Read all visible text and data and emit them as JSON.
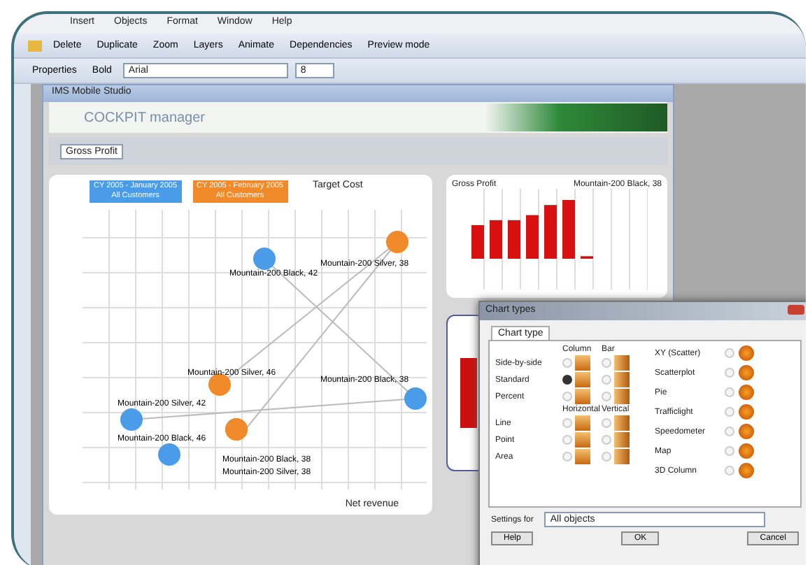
{
  "menu": [
    "Insert",
    "Objects",
    "Format",
    "Window",
    "Help"
  ],
  "toolbar_1": [
    "Delete",
    "Duplicate",
    "Zoom",
    "Layers",
    "Animate",
    "Dependencies",
    "Preview mode"
  ],
  "toolbar_2": {
    "properties": "Properties",
    "bold": "Bold",
    "font": "Arial",
    "size": "8"
  },
  "inner_window": {
    "title": "IMS Mobile Studio",
    "logo": "COCKPIT manager",
    "filter": "Gross Profit"
  },
  "scatter": {
    "legend": [
      {
        "label": "CY 2005 - January 2005",
        "sub": "All Customers",
        "color": "#4a9be8"
      },
      {
        "label": "CY 2005 - February 2005",
        "sub": "All Customers",
        "color": "#f08a2a"
      }
    ],
    "title": "Target Cost",
    "xlabel": "Net revenue",
    "points": [
      {
        "label": "Mountain-200 Black, 42",
        "color": "#4a9be8"
      },
      {
        "label": "Mountain-200 Silver, 38",
        "color": "#f08a2a"
      },
      {
        "label": "Mountain-200 Silver, 46",
        "color": "#f08a2a"
      },
      {
        "label": "Mountain-200 Black, 38",
        "color": "#4a9be8"
      },
      {
        "label": "Mountain-200 Silver, 42",
        "color": "#4a9be8"
      },
      {
        "label": "Mountain-200 Black, 46",
        "color": "#4a9be8"
      },
      {
        "label": "Mountain-200 Black, 38",
        "color": "#f08a2a"
      },
      {
        "label": "Mountain-200 Silver, 38",
        "color": "#f08a2a"
      }
    ]
  },
  "bar_panel": {
    "title": "Gross Profit",
    "series": "Mountain-200 Black, 38"
  },
  "dialog": {
    "title": "Chart types",
    "tab": "Chart type",
    "headers": [
      "Column",
      "Bar"
    ],
    "headers_2": [
      "Horizontal",
      "Vertical"
    ],
    "rows": [
      {
        "label": "Side-by-side",
        "selected": false,
        "bar_selected": false
      },
      {
        "label": "Standard",
        "selected": true,
        "bar_selected": false
      },
      {
        "label": "Percent",
        "selected": false,
        "bar_selected": false
      },
      {
        "label": "Line",
        "selected": false,
        "bar_selected": false
      },
      {
        "label": "Point",
        "selected": false,
        "bar_selected": false
      },
      {
        "label": "Area",
        "selected": false,
        "bar_selected": false
      }
    ],
    "types": [
      {
        "label": "XY (Scatter)",
        "selected": false
      },
      {
        "label": "Scatterplot",
        "selected": false
      },
      {
        "label": "Pie",
        "selected": false
      },
      {
        "label": "Trafficlight",
        "selected": false
      },
      {
        "label": "Speedometer",
        "selected": false
      },
      {
        "label": "Map",
        "selected": false
      },
      {
        "label": "3D Column",
        "selected": false
      }
    ],
    "settings_label": "Settings for",
    "settings_value": "All objects",
    "buttons": [
      "Help",
      "OK",
      "Cancel"
    ]
  }
}
